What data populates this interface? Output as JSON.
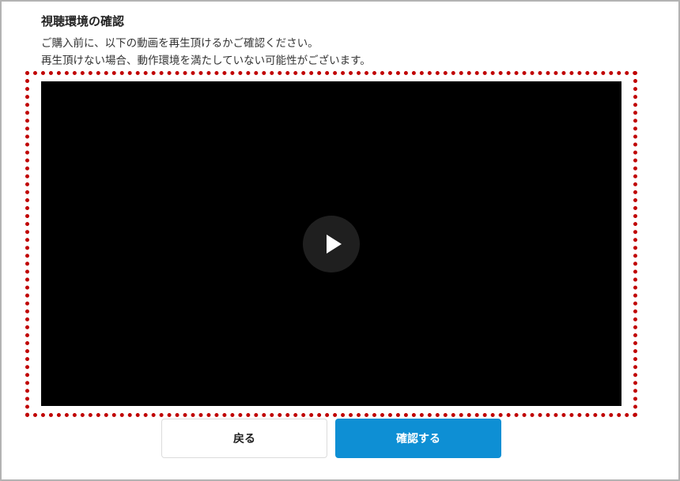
{
  "section": {
    "title": "視聴環境の確認",
    "description_line1": "ご購入前に、以下の動画を再生頂けるかご確認ください。",
    "description_line2": "再生頂けない場合、動作環境を満たしていない可能性がございます。"
  },
  "player": {
    "play_icon": "play-icon"
  },
  "actions": {
    "back_label": "戻る",
    "confirm_label": "確認する"
  },
  "colors": {
    "accent": "#0e8fd4",
    "highlight": "#c00000"
  }
}
